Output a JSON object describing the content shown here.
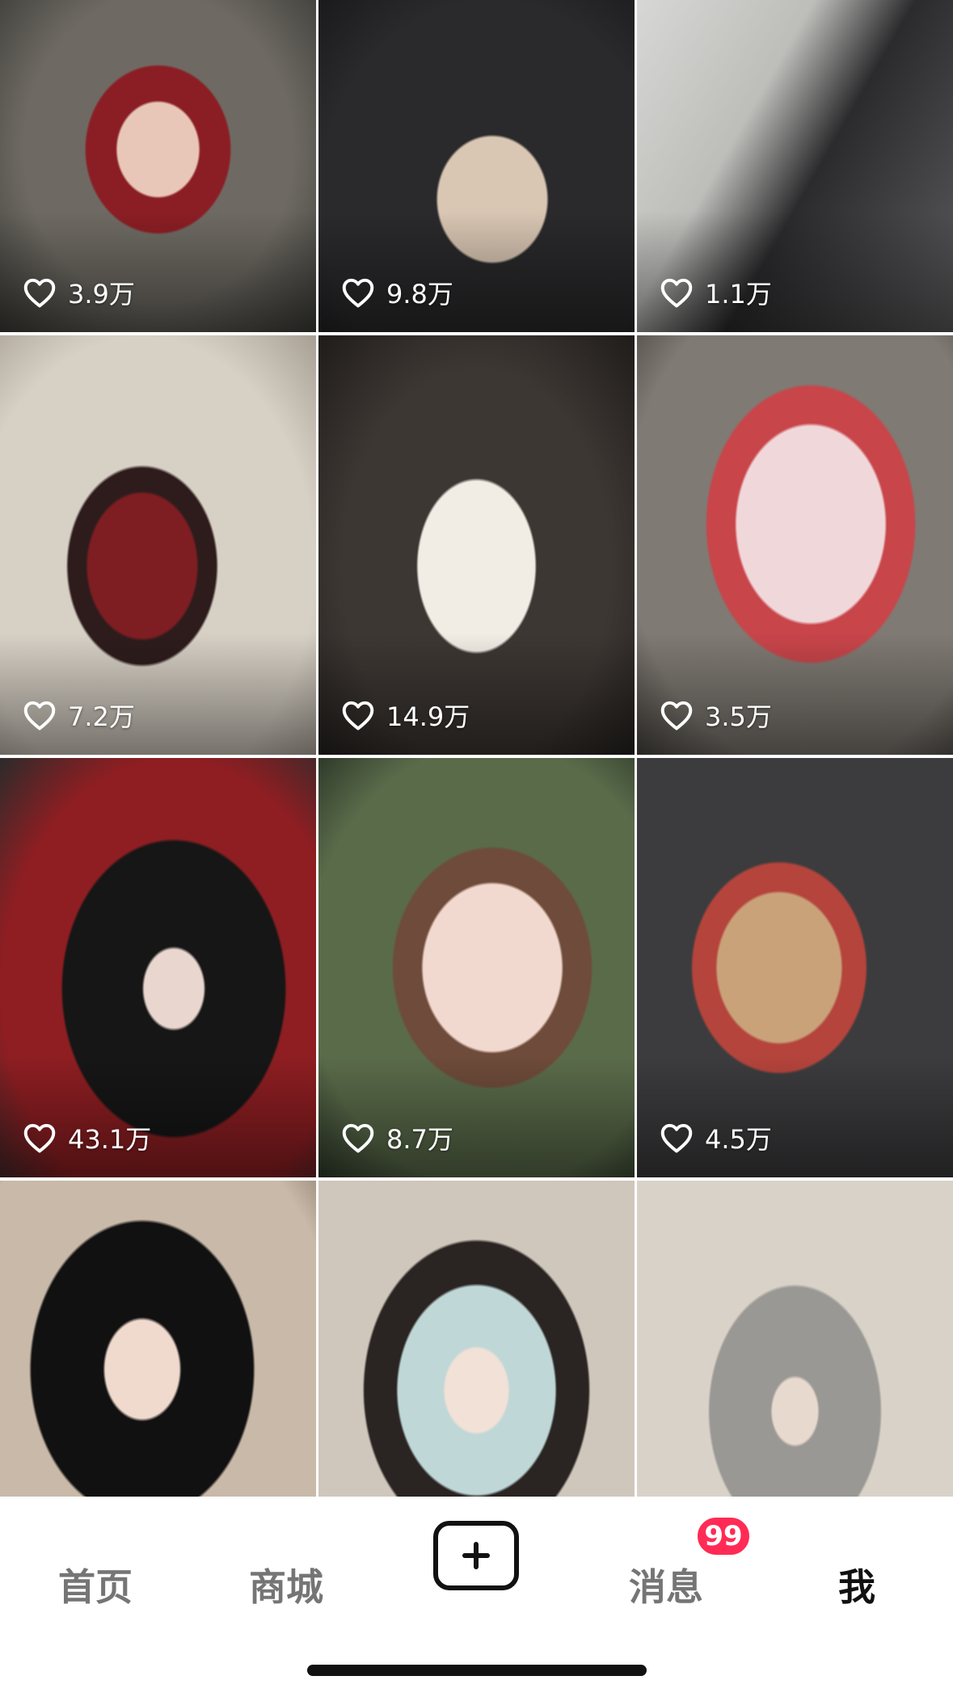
{
  "feed": {
    "tiles": [
      {
        "likes": "3.9万"
      },
      {
        "likes": "9.8万"
      },
      {
        "likes": "1.1万"
      },
      {
        "likes": "7.2万"
      },
      {
        "likes": "14.9万"
      },
      {
        "likes": "3.5万"
      },
      {
        "likes": "43.1万"
      },
      {
        "likes": "8.7万"
      },
      {
        "likes": "4.5万"
      },
      {
        "likes": ""
      },
      {
        "likes": ""
      },
      {
        "likes": ""
      }
    ]
  },
  "tabbar": {
    "home": "首页",
    "mall": "商城",
    "create_icon": "plus-icon",
    "messages": "消息",
    "messages_badge": "99",
    "me": "我",
    "active_tab": "me"
  },
  "colors": {
    "badge": "#ff2b55",
    "active_tab": "#111111",
    "inactive_tab": "#757575"
  }
}
